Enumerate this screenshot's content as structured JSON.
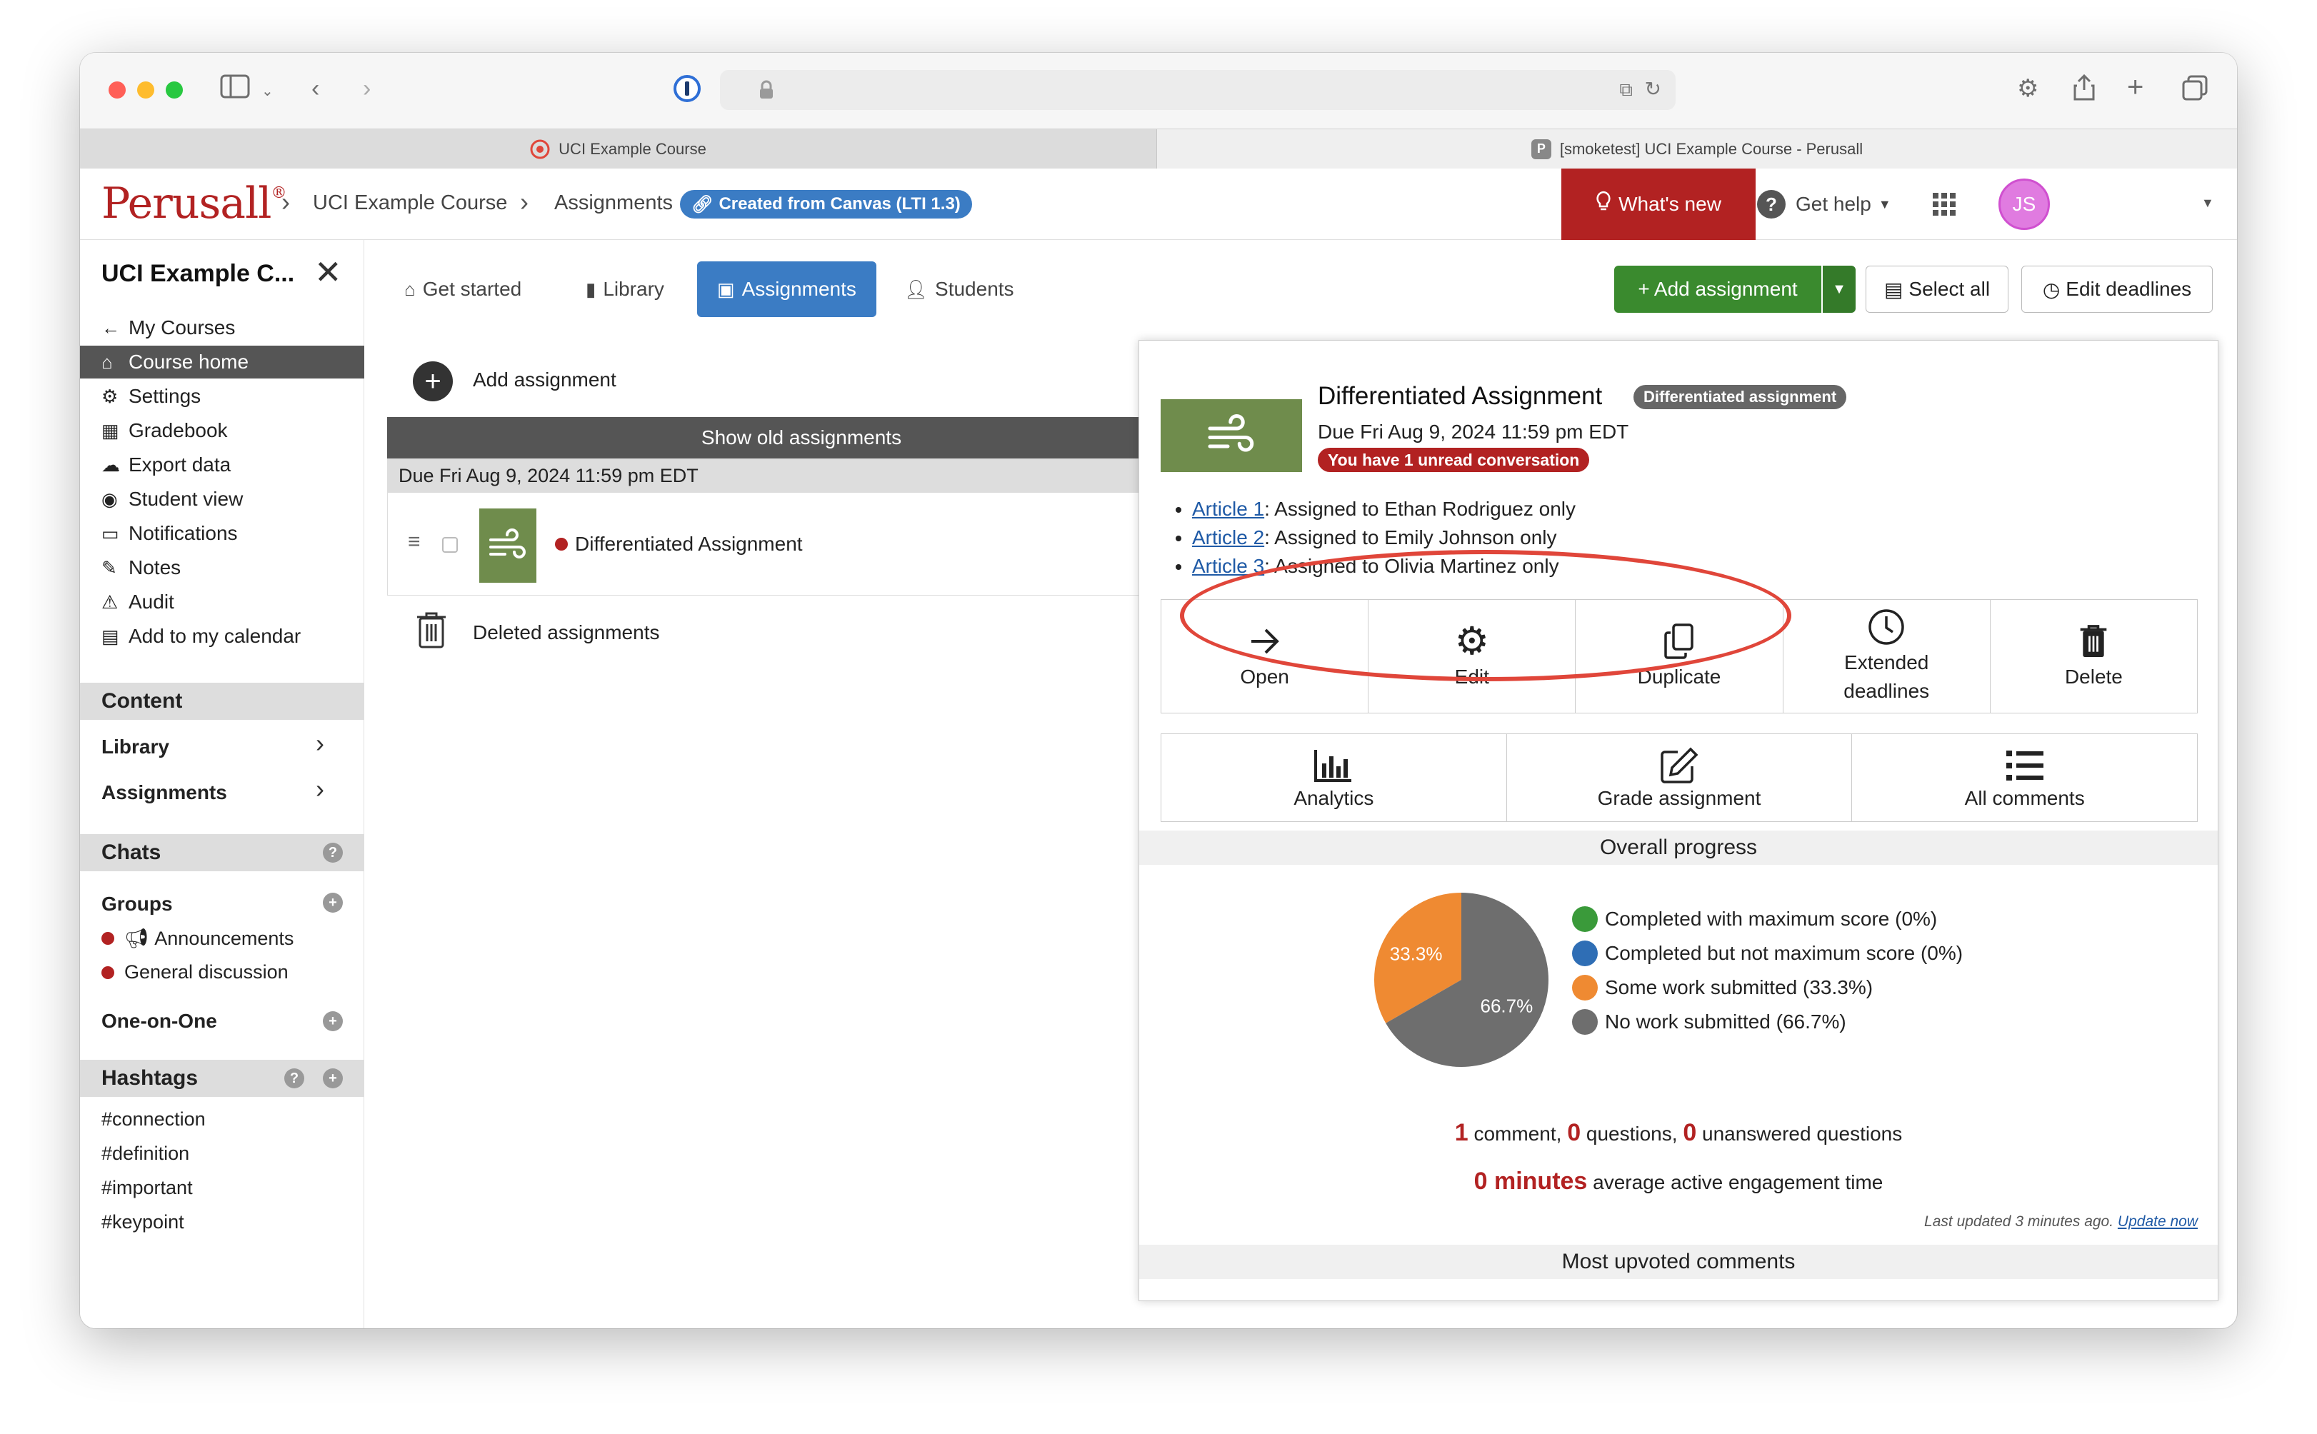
{
  "browser": {
    "tabs": [
      {
        "label": "UCI Example Course"
      },
      {
        "label": "[smoketest] UCI Example Course - Perusall",
        "favicon": "P"
      }
    ]
  },
  "header": {
    "logo": "Perusall",
    "logo_mark": "®",
    "breadcrumb": [
      "UCI Example Course",
      "Assignments"
    ],
    "lti_badge": "Created from Canvas (LTI 1.3)",
    "whats_new": "What's new",
    "get_help": "Get help",
    "help_mark": "?",
    "avatar_initials": "JS"
  },
  "sidebar": {
    "title": "UCI Example C...",
    "items": [
      {
        "label": "My Courses",
        "icon": "arrow-left-icon"
      },
      {
        "label": "Course home",
        "icon": "home-icon",
        "active": true
      },
      {
        "label": "Settings",
        "icon": "gear-icon"
      },
      {
        "label": "Gradebook",
        "icon": "table-icon"
      },
      {
        "label": "Export data",
        "icon": "cloud-download-icon"
      },
      {
        "label": "Student view",
        "icon": "eye-icon"
      },
      {
        "label": "Notifications",
        "icon": "inbox-icon"
      },
      {
        "label": "Notes",
        "icon": "pencil-icon"
      },
      {
        "label": "Audit",
        "icon": "warning-icon"
      },
      {
        "label": "Add to my calendar",
        "icon": "calendar-icon"
      }
    ],
    "content_header": "Content",
    "content_items": [
      "Library",
      "Assignments"
    ],
    "chats_header": "Chats",
    "groups_label": "Groups",
    "group_chats": [
      "Announcements",
      "General discussion"
    ],
    "one_on_one": "One-on-One",
    "hashtags_header": "Hashtags",
    "hashtags": [
      "#connection",
      "#definition",
      "#important",
      "#keypoint"
    ]
  },
  "nav": {
    "tabs": [
      {
        "label": "Get started",
        "icon": "home-icon"
      },
      {
        "label": "Library",
        "icon": "book-icon"
      },
      {
        "label": "Assignments",
        "icon": "calendar-check-icon",
        "active": true
      },
      {
        "label": "Students",
        "icon": "user-icon"
      }
    ],
    "add_assignment": "+ Add assignment",
    "select_all": "Select all",
    "edit_deadlines": "Edit deadlines"
  },
  "list": {
    "add_assignment": "Add assignment",
    "show_old": "Show old assignments",
    "due_group": "Due Fri Aug 9, 2024 11:59 pm EDT",
    "assignment_title": "Differentiated Assignment",
    "deleted": "Deleted assignments"
  },
  "detail": {
    "title": "Differentiated Assignment",
    "badge": "Differentiated assignment",
    "due": "Due Fri Aug 9, 2024 11:59 pm EDT",
    "unread": "You have 1 unread conversation",
    "articles": [
      {
        "link": "Article 1",
        "text": ": Assigned to Ethan Rodriguez only"
      },
      {
        "link": "Article 2",
        "text": ": Assigned to Emily Johnson only"
      },
      {
        "link": "Article 3",
        "text": ": Assigned to Olivia Martinez only"
      }
    ],
    "actions": [
      {
        "label": "Open",
        "icon": "arrow-right-icon"
      },
      {
        "label": "Edit",
        "icon": "gear-icon"
      },
      {
        "label": "Duplicate",
        "icon": "copy-icon"
      },
      {
        "label": "Extended deadlines",
        "icon": "clock-icon"
      },
      {
        "label": "Delete",
        "icon": "trash-icon"
      }
    ],
    "actions2": [
      {
        "label": "Analytics",
        "icon": "bar-chart-icon"
      },
      {
        "label": "Grade assignment",
        "icon": "edit-square-icon"
      },
      {
        "label": "All comments",
        "icon": "list-icon"
      }
    ],
    "progress_header": "Overall progress",
    "legend": [
      {
        "label": "Completed with maximum score (0%)",
        "color": "#3a9a3a"
      },
      {
        "label": "Completed but not maximum score (0%)",
        "color": "#2f6eb5"
      },
      {
        "label": "Some work submitted (33.3%)",
        "color": "#ef8a32"
      },
      {
        "label": "No work submitted (66.7%)",
        "color": "#6e6e6e"
      }
    ],
    "pie": {
      "slices": [
        {
          "label": "33.3%",
          "value": 33.3,
          "color": "#ef8a32"
        },
        {
          "label": "66.7%",
          "value": 66.7,
          "color": "#6e6e6e"
        }
      ]
    },
    "stats": {
      "comments_n": "1",
      "comments_t": "comment,",
      "questions_n": "0",
      "questions_t": "questions,",
      "unanswered_n": "0",
      "unanswered_t": "unanswered questions",
      "minutes_n": "0 minutes",
      "minutes_t": "average active engagement time"
    },
    "last_updated": "Last updated 3 minutes ago.",
    "update_now": "Update now",
    "upvoted_header": "Most upvoted comments"
  }
}
